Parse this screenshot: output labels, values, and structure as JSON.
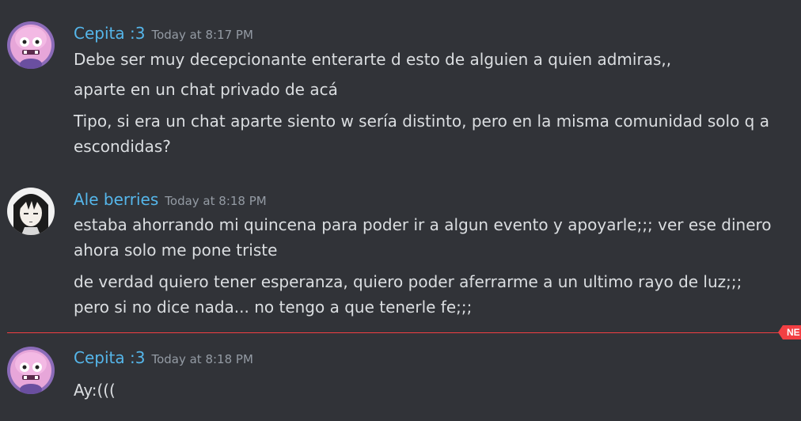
{
  "messages": [
    {
      "username": "Cepita :3",
      "timestamp": "Today at 8:17 PM",
      "avatar_icon": "pink-bird-avatar-icon",
      "lines": [
        "Debe ser muy decepcionante enterarte d esto de alguien a quien admiras,,",
        "aparte en un chat privado de acá",
        "Tipo, si era un chat aparte siento w sería distinto, pero en la misma comunidad solo q a",
        "escondidas?"
      ]
    },
    {
      "username": "Ale berries",
      "timestamp": "Today at 8:18 PM",
      "avatar_icon": "anime-girl-avatar-icon",
      "lines": [
        "estaba ahorrando mi quincena para poder ir a algun evento y apoyarle;;; ver ese dinero",
        "ahora solo me pone triste",
        "de verdad quiero tener esperanza, quiero poder aferrarme a un ultimo rayo de luz;;;",
        "pero si no dice nada... no tengo a que tenerle fe;;;"
      ]
    },
    {
      "username": "Cepita :3",
      "timestamp": "Today at 8:18 PM",
      "avatar_icon": "pink-bird-avatar-icon",
      "lines": [
        "Ay:((("
      ]
    }
  ],
  "new_divider": {
    "label": "NE"
  },
  "colors": {
    "background": "#313338",
    "username": "#55b6ea",
    "timestamp": "#949ba4",
    "message_text": "#dbdee1",
    "new_divider": "#f23f43"
  }
}
